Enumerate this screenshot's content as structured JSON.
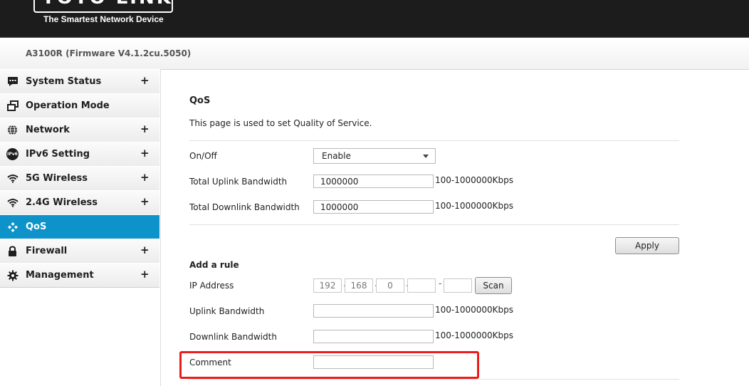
{
  "brand": {
    "logo_text": "TOTO LINK",
    "tagline": "The Smartest Network Device"
  },
  "model": "A3100R (Firmware V4.1.2cu.5050)",
  "sidebar": {
    "items": [
      {
        "label": "System Status",
        "expand": "+"
      },
      {
        "label": "Operation Mode",
        "expand": ""
      },
      {
        "label": "Network",
        "expand": "+"
      },
      {
        "label": "IPv6 Setting",
        "expand": "+",
        "icon_text": "IPv6"
      },
      {
        "label": "5G Wireless",
        "expand": "+"
      },
      {
        "label": "2.4G Wireless",
        "expand": "+"
      },
      {
        "label": "QoS",
        "expand": "",
        "active": true
      },
      {
        "label": "Firewall",
        "expand": "+"
      },
      {
        "label": "Management",
        "expand": "+"
      }
    ]
  },
  "main": {
    "title": "QoS",
    "description": "This page is used to set Quality of Service.",
    "onoff": {
      "label": "On/Off",
      "value": "Enable"
    },
    "uplink_total": {
      "label": "Total Uplink Bandwidth",
      "value": "1000000",
      "range": "100-1000000Kbps"
    },
    "downlink_total": {
      "label": "Total Downlink Bandwidth",
      "value": "1000000",
      "range": "100-1000000Kbps"
    },
    "apply_label": "Apply",
    "add_rule": {
      "title": "Add a rule",
      "ip_label": "IP Address",
      "ip": {
        "o1": "192",
        "o2": "168",
        "o3": "0",
        "o4": "",
        "end": ""
      },
      "ip_dot": "·",
      "ip_dash": "-",
      "scan_label": "Scan",
      "uplink": {
        "label": "Uplink Bandwidth",
        "value": "",
        "range": "100-1000000Kbps"
      },
      "downlink": {
        "label": "Downlink Bandwidth",
        "value": "",
        "range": "100-1000000Kbps"
      },
      "comment": {
        "label": "Comment",
        "value": ""
      }
    }
  },
  "colors": {
    "header_bg": "#1c1c1c",
    "active_nav": "#0d93c9",
    "highlight": "#ee1b1b"
  }
}
